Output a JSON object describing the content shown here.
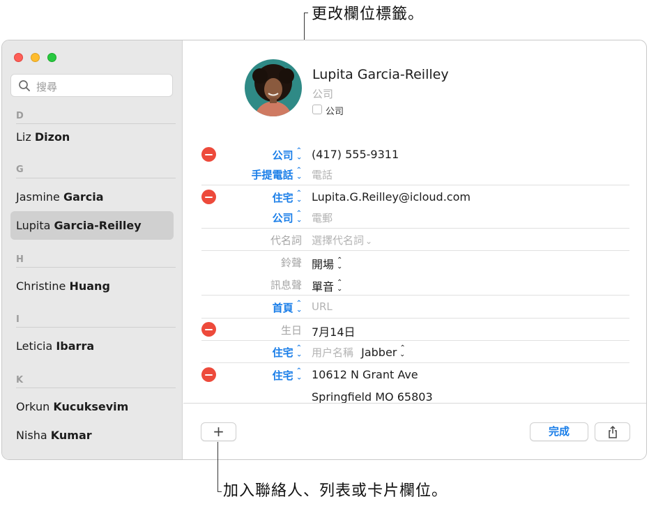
{
  "callouts": {
    "top": "更改欄位標籤。",
    "bottom": "加入聯絡人、列表或卡片欄位。"
  },
  "sidebar": {
    "search_placeholder": "搜尋",
    "sections": [
      {
        "letter": "D",
        "contacts": [
          {
            "first": "Liz",
            "last": "Dizon"
          }
        ]
      },
      {
        "letter": "G",
        "contacts": [
          {
            "first": "Jasmine",
            "last": "Garcia"
          },
          {
            "first": "Lupita",
            "last": "Garcia-Reilley",
            "selected": true
          }
        ]
      },
      {
        "letter": "H",
        "contacts": [
          {
            "first": "Christine",
            "last": "Huang"
          }
        ]
      },
      {
        "letter": "I",
        "contacts": [
          {
            "first": "Leticia",
            "last": "Ibarra"
          }
        ]
      },
      {
        "letter": "K",
        "contacts": [
          {
            "first": "Orkun",
            "last": "Kucuksevim"
          },
          {
            "first": "Nisha",
            "last": "Kumar"
          }
        ]
      }
    ]
  },
  "card": {
    "name": "Lupita  Garcia-Reilley",
    "company_placeholder": "公司",
    "company_checkbox_label": "公司",
    "fields": [
      {
        "label": "公司",
        "value": "(417) 555-9311"
      },
      {
        "label": "手提電話",
        "value": "電話"
      },
      {
        "label": "住宅",
        "value": "Lupita.G.Reilley@icloud.com"
      },
      {
        "label": "公司",
        "value": "電郵"
      },
      {
        "label": "代名詞",
        "value": "選擇代名詞"
      },
      {
        "label": "鈴聲",
        "value": "開場"
      },
      {
        "label": "訊息聲",
        "value": "單音"
      },
      {
        "label": "首頁",
        "value": "URL"
      },
      {
        "label": "生日",
        "value": "7月14日"
      },
      {
        "label": "住宅",
        "value": "用户名稱",
        "service": "Jabber"
      },
      {
        "label": "住宅",
        "value": "10612 N Grant Ave",
        "value2": "Springfield MO 65803"
      }
    ]
  },
  "footer": {
    "add_label": "+",
    "done_label": "完成"
  },
  "colors": {
    "accent": "#1a7ee8",
    "delete": "#ed4a3b",
    "sidebar_bg": "#e8e8e8",
    "selection": "#d0d0d0"
  },
  "icons": [
    "search-icon",
    "minus-circle-icon",
    "chevron-updown-icon",
    "plus-icon",
    "share-icon"
  ]
}
